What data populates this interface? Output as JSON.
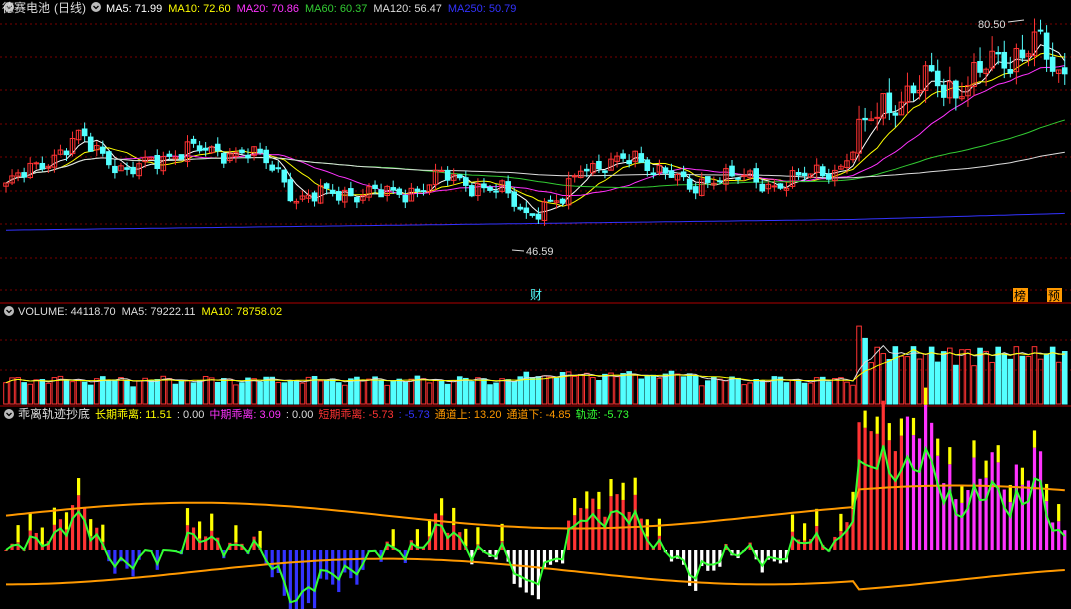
{
  "stock": {
    "name": "德赛电池",
    "period": "(日线)"
  },
  "panels": {
    "price": {
      "ma_legend": [
        {
          "label": "MA5: 71.99",
          "color": "#ffffff"
        },
        {
          "label": "MA10: 72.60",
          "color": "#ffff00"
        },
        {
          "label": "MA20: 70.86",
          "color": "#ff33ff"
        },
        {
          "label": "MA60: 60.37",
          "color": "#33cc33"
        },
        {
          "label": "MA120: 56.47",
          "color": "#dddddd"
        },
        {
          "label": "MA250: 50.79",
          "color": "#3333ff"
        }
      ],
      "high_label": "80.50",
      "low_label": "46.59",
      "markers": [
        "财",
        "榜",
        "预"
      ]
    },
    "volume": {
      "legend": [
        {
          "label": "VOLUME: 44118.70",
          "color": "#dddddd"
        },
        {
          "label": "MA5: 79222.11",
          "color": "#dddddd"
        },
        {
          "label": "MA10: 78758.02",
          "color": "#ffff00"
        }
      ]
    },
    "indicator": {
      "name": "乖离轨迹抄底",
      "legend": [
        {
          "label": "长期乖离: 11.51",
          "color": "#ffff00"
        },
        {
          "label": ": 0.00",
          "color": "#dddddd"
        },
        {
          "label": "中期乖离: 3.09",
          "color": "#ff33ff"
        },
        {
          "label": ": 0.00",
          "color": "#dddddd"
        },
        {
          "label": "短期乖离: -5.73",
          "color": "#ff3333"
        },
        {
          "label": ": -5.73",
          "color": "#3333ff"
        },
        {
          "label": "通道上: 13.20",
          "color": "#ff9900"
        },
        {
          "label": "通道下: -4.85",
          "color": "#ff9900"
        },
        {
          "label": "轨迹: -5.73",
          "color": "#33ff33"
        }
      ]
    }
  },
  "colors": {
    "up": "#ff3333",
    "down": "#54ffff",
    "grid": "#7a0000",
    "frame": "#b00000"
  },
  "chart_data": {
    "type": "candlestick",
    "y_high": 80.5,
    "y_low": 46.59,
    "ma_last": {
      "MA5": 71.99,
      "MA10": 72.6,
      "MA20": 70.86,
      "MA60": 60.37,
      "MA120": 56.47,
      "MA250": 50.79
    },
    "volume_last": 44118.7,
    "volume_ma": {
      "MA5": 79222.11,
      "MA10": 78758.02
    },
    "indicator_last": {
      "长期乖离": 11.51,
      "中期乖离": 3.09,
      "短期乖离": -5.73,
      "通道上": 13.2,
      "通道下": -4.85,
      "轨迹": -5.73
    }
  }
}
